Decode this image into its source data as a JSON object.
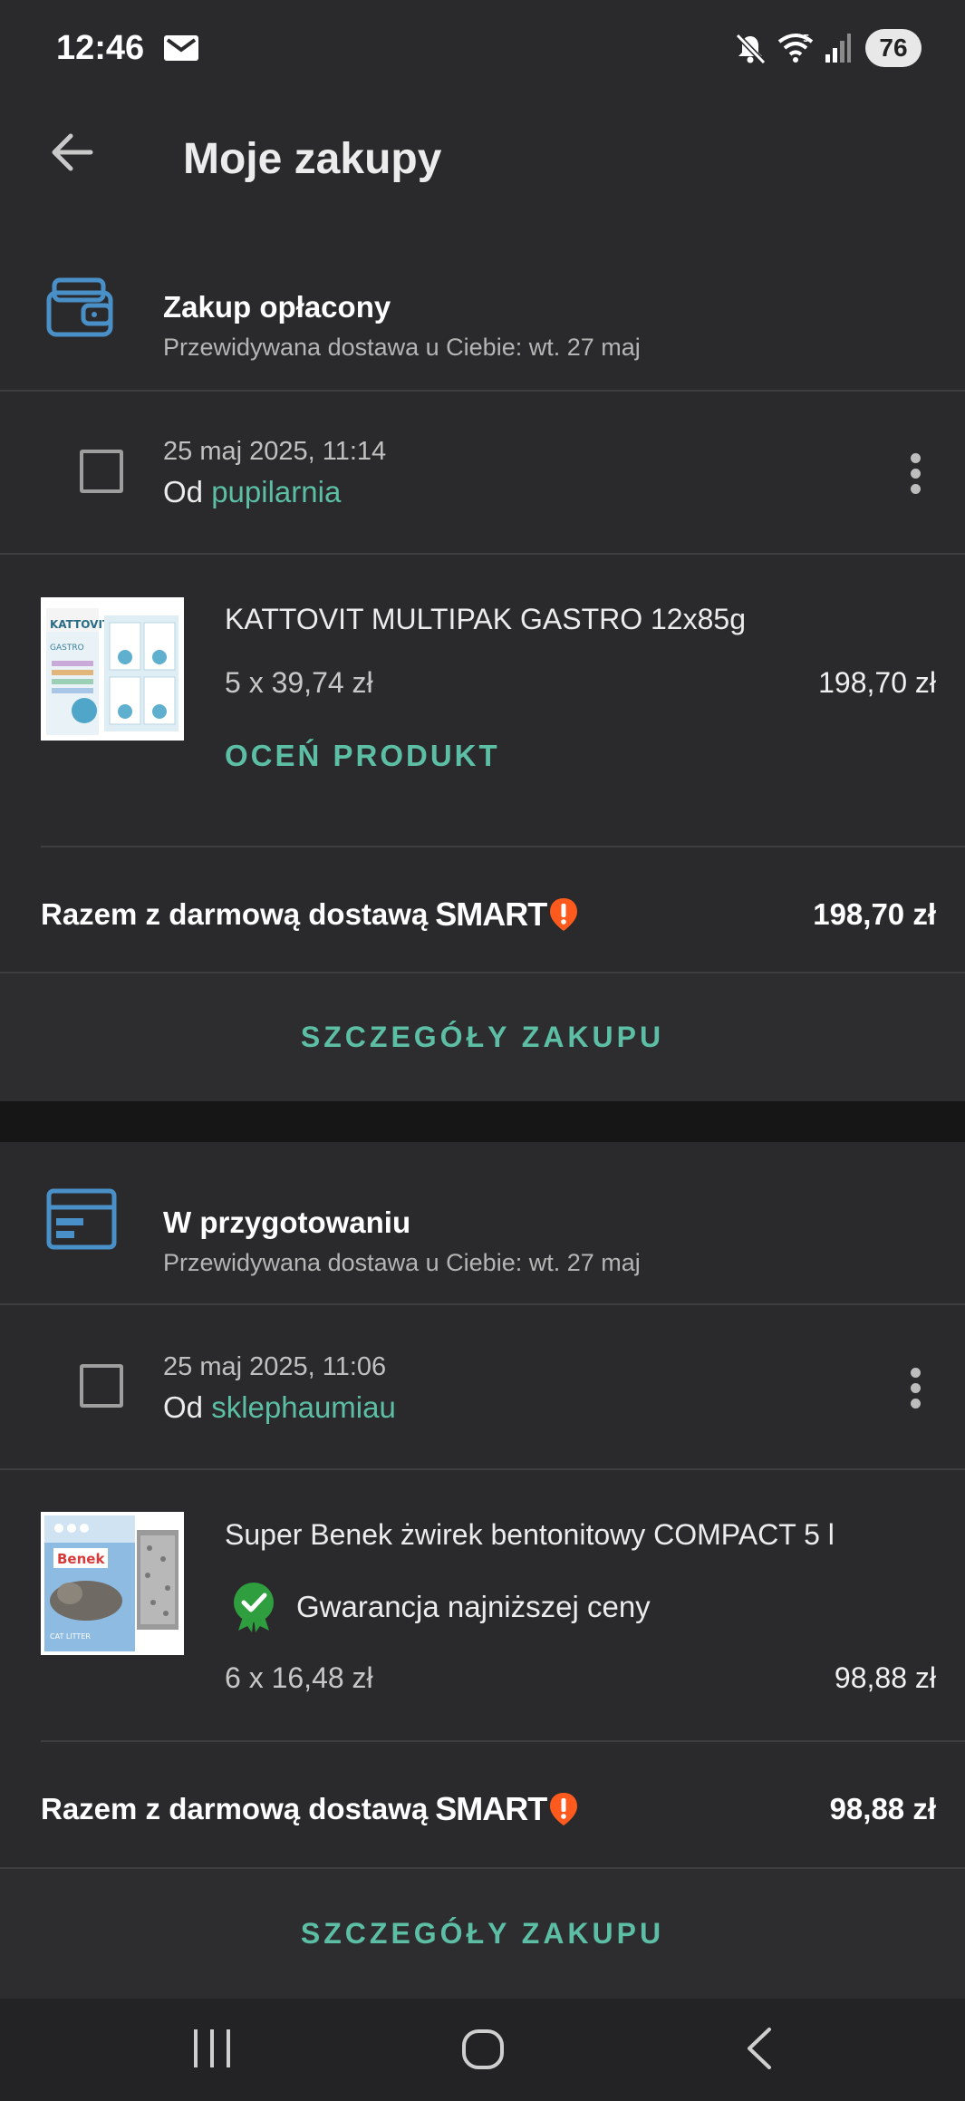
{
  "status_bar": {
    "time": "12:46",
    "battery": "76",
    "icons": [
      "mail-icon",
      "mute-icon",
      "wifi-icon",
      "signal-icon"
    ]
  },
  "app_bar": {
    "title": "Moje zakupy",
    "back_icon": "arrow-left-icon"
  },
  "purchases": [
    {
      "status_title": "Zakup opłacony",
      "status_sub": "Przewidywana dostawa u Ciebie: wt. 27 maj",
      "date": "25 maj 2025, 11:14",
      "seller_prefix": "Od",
      "seller_name": "pupilarnia",
      "product_name": "KATTOVIT MULTIPAK GASTRO 12x85g",
      "quantity_price": "5 x 39,74 zł",
      "line_price": "198,70 zł",
      "rate_label": "OCEŃ PRODUKT",
      "total_label": "Razem z darmową dostawą",
      "smart_label": "SMART",
      "total_value": "198,70 zł",
      "details_label": "SZCZEGÓŁY ZAKUPU",
      "thumb_text": "KATTOVIT",
      "thumb_sub": "GASTRO"
    },
    {
      "status_title": "W przygotowaniu",
      "status_sub": "Przewidywana dostawa u Ciebie: wt. 27 maj",
      "date": "25 maj 2025, 11:06",
      "seller_prefix": "Od",
      "seller_name": "sklephaumiau",
      "product_name": "Super Benek żwirek bentonitowy COMPACT 5 l",
      "guarantee_label": "Gwarancja najniższej ceny",
      "quantity_price": "6 x 16,48 zł",
      "line_price": "98,88 zł",
      "total_label": "Razem z darmową dostawą",
      "smart_label": "SMART",
      "total_value": "98,88 zł",
      "details_label": "SZCZEGÓŁY ZAKUPU",
      "thumb_text": "Benek",
      "thumb_sub": "CAT LITTER"
    }
  ],
  "colors": {
    "accent": "#5cbfa5",
    "status_icon": "#4a90c8",
    "smart_badge": "#ff5a1e",
    "guarantee": "#2e9e3f"
  }
}
